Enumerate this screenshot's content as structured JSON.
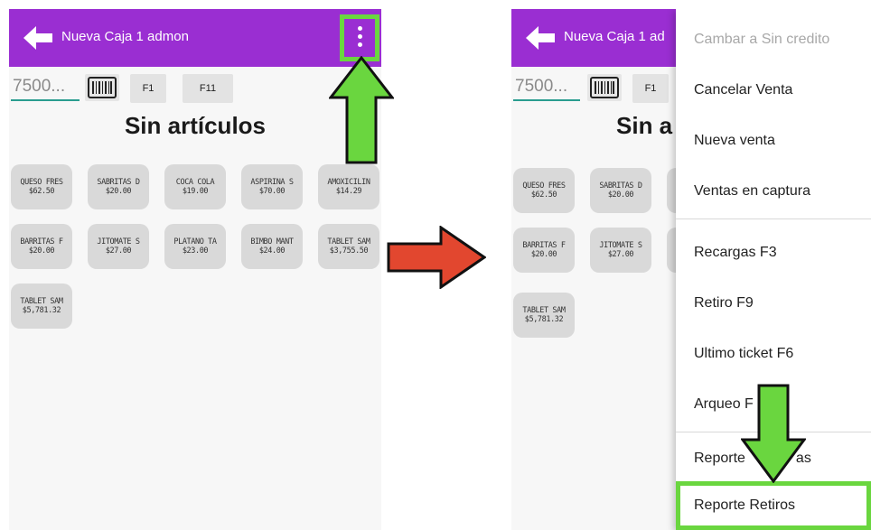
{
  "colors": {
    "appbar": "#9a2ed2",
    "highlight": "#6ad63f",
    "transition_arrow": "#e2472f"
  },
  "left_screen": {
    "appbar_title": "Nueva Caja 1 admon",
    "search_placeholder": "7500...",
    "key_f1": "F1",
    "key_f11": "F11",
    "empty_title": "Sin artículos",
    "products": [
      {
        "name": "QUESO FRES",
        "price": "$62.50"
      },
      {
        "name": "SABRITAS D",
        "price": "$20.00"
      },
      {
        "name": "COCA COLA",
        "price": "$19.00"
      },
      {
        "name": "ASPIRINA S",
        "price": "$70.00"
      },
      {
        "name": "AMOXICILIN",
        "price": "$14.29"
      },
      {
        "name": "BARRITAS F",
        "price": "$20.00"
      },
      {
        "name": "JITOMATE S",
        "price": "$27.00"
      },
      {
        "name": "PLATANO TA",
        "price": "$23.00"
      },
      {
        "name": "BIMBO MANT",
        "price": "$24.00"
      },
      {
        "name": "TABLET SAM",
        "price": "$3,755.50"
      },
      {
        "name": "TABLET SAM",
        "price": "$5,781.32"
      }
    ]
  },
  "right_screen": {
    "appbar_title": "Nueva Caja 1 ad",
    "search_placeholder": "7500...",
    "key_f1": "F1",
    "empty_title": "Sin a",
    "products": [
      {
        "name": "QUESO FRES",
        "price": "$62.50"
      },
      {
        "name": "SABRITAS D",
        "price": "$20.00"
      },
      {
        "name": "BARRITAS F",
        "price": "$20.00"
      },
      {
        "name": "JITOMATE S",
        "price": "$27.00"
      },
      {
        "name": "TABLET SAM",
        "price": "$5,781.32"
      }
    ],
    "menu": {
      "items": [
        "Cambar a Sin credito",
        "Cancelar Venta",
        "Nueva venta",
        "Ventas en captura",
        "Recargas F3",
        "Retiro F9",
        "Ultimo ticket F6",
        "Arqueo F",
        "Reporte",
        "Reporte Retiros"
      ],
      "tail_fragments": {
        "reporte_ventas": "as"
      }
    }
  }
}
